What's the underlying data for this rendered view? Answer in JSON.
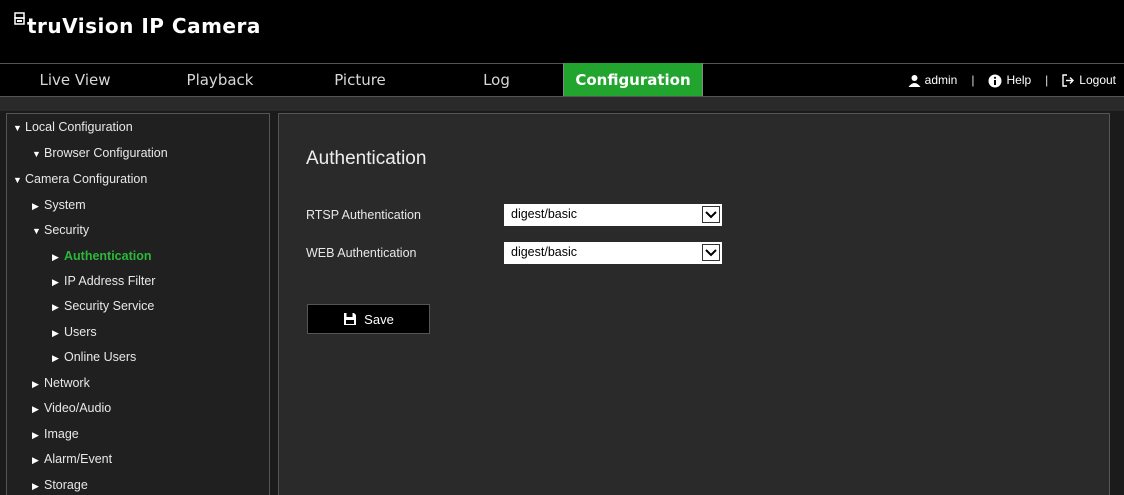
{
  "header": {
    "logo_mark": "Ƀ",
    "logo_text": "truVision  IP Camera"
  },
  "nav": {
    "tabs": [
      {
        "label": "Live View"
      },
      {
        "label": "Playback"
      },
      {
        "label": "Picture"
      },
      {
        "label": "Log"
      },
      {
        "label": "Configuration",
        "active": true
      }
    ],
    "user": "admin",
    "help": "Help",
    "logout": "Logout",
    "separator": "|"
  },
  "sidebar": {
    "items": [
      {
        "label": "Local Configuration",
        "arrow": "▼"
      },
      {
        "label": "Browser Configuration",
        "arrow": "▼"
      },
      {
        "label": "Camera Configuration",
        "arrow": "▼"
      },
      {
        "label": "System",
        "arrow": "▶"
      },
      {
        "label": "Security",
        "arrow": "▼"
      },
      {
        "label": "Authentication",
        "arrow": "▶",
        "active": true
      },
      {
        "label": "IP Address Filter",
        "arrow": "▶"
      },
      {
        "label": "Security Service",
        "arrow": "▶"
      },
      {
        "label": "Users",
        "arrow": "▶"
      },
      {
        "label": "Online Users",
        "arrow": "▶"
      },
      {
        "label": "Network",
        "arrow": "▶"
      },
      {
        "label": "Video/Audio",
        "arrow": "▶"
      },
      {
        "label": "Image",
        "arrow": "▶"
      },
      {
        "label": "Alarm/Event",
        "arrow": "▶"
      },
      {
        "label": "Storage",
        "arrow": "▶"
      }
    ]
  },
  "main": {
    "title": "Authentication",
    "rtsp": {
      "label": "RTSP Authentication",
      "value": "digest/basic"
    },
    "web": {
      "label": "WEB Authentication",
      "value": "digest/basic"
    },
    "save_label": "Save"
  },
  "colors": {
    "accent": "#21a52f",
    "active_text": "#2bb73a"
  }
}
